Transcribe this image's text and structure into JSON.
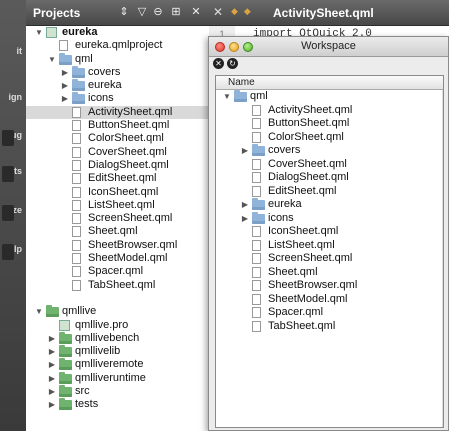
{
  "modebar": {
    "items": [
      {
        "label": "it"
      },
      {
        "label": "ign"
      },
      {
        "label": "ug"
      },
      {
        "label": "ects"
      },
      {
        "label": "yze"
      },
      {
        "label": "lp"
      }
    ]
  },
  "projects": {
    "title": "Projects",
    "tree": [
      {
        "label": "eureka",
        "type": "project",
        "level": 0,
        "expanded": true,
        "bold": true
      },
      {
        "label": "eureka.qmlproject",
        "type": "file",
        "level": 1
      },
      {
        "label": "qml",
        "type": "folder",
        "level": 1,
        "expanded": true
      },
      {
        "label": "covers",
        "type": "folder",
        "level": 2,
        "expanded": false
      },
      {
        "label": "eureka",
        "type": "folder",
        "level": 2,
        "expanded": false
      },
      {
        "label": "icons",
        "type": "folder",
        "level": 2,
        "expanded": false
      },
      {
        "label": "ActivitySheet.qml",
        "type": "file",
        "level": 2,
        "selected": true
      },
      {
        "label": "ButtonSheet.qml",
        "type": "file",
        "level": 2
      },
      {
        "label": "ColorSheet.qml",
        "type": "file",
        "level": 2
      },
      {
        "label": "CoverSheet.qml",
        "type": "file",
        "level": 2
      },
      {
        "label": "DialogSheet.qml",
        "type": "file",
        "level": 2
      },
      {
        "label": "EditSheet.qml",
        "type": "file",
        "level": 2
      },
      {
        "label": "IconSheet.qml",
        "type": "file",
        "level": 2
      },
      {
        "label": "ListSheet.qml",
        "type": "file",
        "level": 2
      },
      {
        "label": "ScreenSheet.qml",
        "type": "file",
        "level": 2
      },
      {
        "label": "Sheet.qml",
        "type": "file",
        "level": 2
      },
      {
        "label": "SheetBrowser.qml",
        "type": "file",
        "level": 2
      },
      {
        "label": "SheetModel.qml",
        "type": "file",
        "level": 2
      },
      {
        "label": "Spacer.qml",
        "type": "file",
        "level": 2
      },
      {
        "label": "TabSheet.qml",
        "type": "file",
        "level": 2
      },
      {
        "label": "",
        "type": "blank",
        "level": 0
      },
      {
        "label": "qmllive",
        "type": "gfolder",
        "level": 0,
        "expanded": true
      },
      {
        "label": "qmllive.pro",
        "type": "proj",
        "level": 1
      },
      {
        "label": "qmllivebench",
        "type": "gfolder",
        "level": 1,
        "expanded": false
      },
      {
        "label": "qmllivelib",
        "type": "gfolder",
        "level": 1,
        "expanded": false
      },
      {
        "label": "qmlliveremote",
        "type": "gfolder",
        "level": 1,
        "expanded": false
      },
      {
        "label": "qmlliveruntime",
        "type": "gfolder",
        "level": 1,
        "expanded": false
      },
      {
        "label": "src",
        "type": "gfolder",
        "level": 1,
        "expanded": false
      },
      {
        "label": "tests",
        "type": "gfolder",
        "level": 1,
        "expanded": false
      }
    ]
  },
  "editor": {
    "tab_title": "ActivitySheet.qml",
    "line_number": "1",
    "code_line": "import QtQuick 2.0"
  },
  "workspace": {
    "title": "Workspace",
    "column_header": "Name",
    "tree": [
      {
        "label": "qml",
        "type": "folder",
        "level": 0,
        "expanded": true
      },
      {
        "label": "ActivitySheet.qml",
        "type": "file",
        "level": 1
      },
      {
        "label": "ButtonSheet.qml",
        "type": "file",
        "level": 1
      },
      {
        "label": "ColorSheet.qml",
        "type": "file",
        "level": 1
      },
      {
        "label": "covers",
        "type": "folder",
        "level": 1,
        "expanded": false
      },
      {
        "label": "CoverSheet.qml",
        "type": "file",
        "level": 1
      },
      {
        "label": "DialogSheet.qml",
        "type": "file",
        "level": 1
      },
      {
        "label": "EditSheet.qml",
        "type": "file",
        "level": 1
      },
      {
        "label": "eureka",
        "type": "folder",
        "level": 1,
        "expanded": false
      },
      {
        "label": "icons",
        "type": "folder",
        "level": 1,
        "expanded": false
      },
      {
        "label": "IconSheet.qml",
        "type": "file",
        "level": 1
      },
      {
        "label": "ListSheet.qml",
        "type": "file",
        "level": 1
      },
      {
        "label": "ScreenSheet.qml",
        "type": "file",
        "level": 1
      },
      {
        "label": "Sheet.qml",
        "type": "file",
        "level": 1
      },
      {
        "label": "SheetBrowser.qml",
        "type": "file",
        "level": 1
      },
      {
        "label": "SheetModel.qml",
        "type": "file",
        "level": 1
      },
      {
        "label": "Spacer.qml",
        "type": "file",
        "level": 1
      },
      {
        "label": "TabSheet.qml",
        "type": "file",
        "level": 1
      }
    ]
  }
}
